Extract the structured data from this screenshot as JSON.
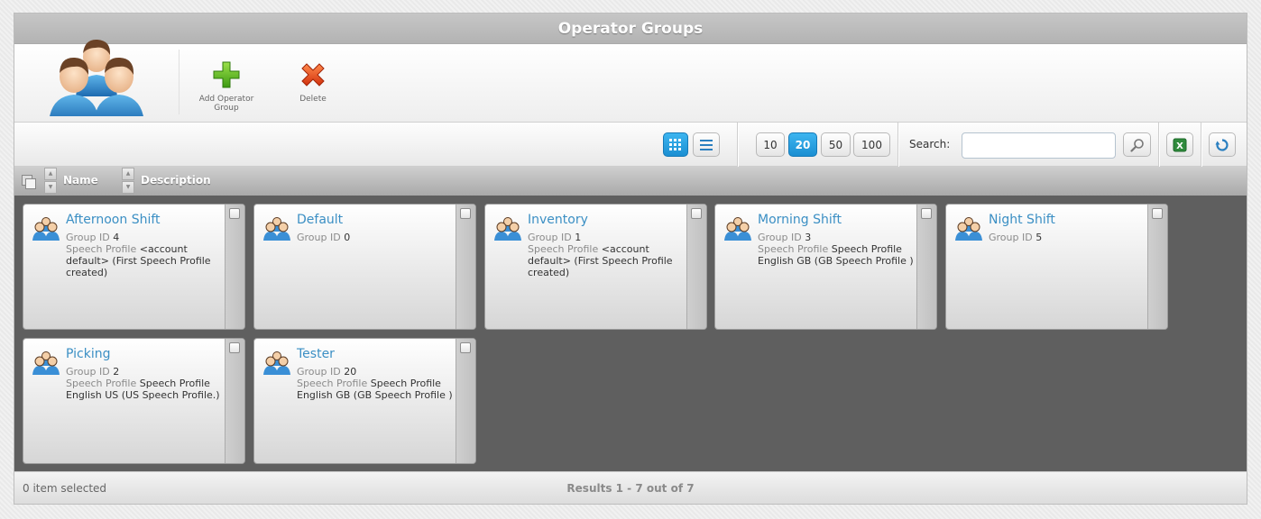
{
  "window": {
    "title": "Operator Groups"
  },
  "toolbar": {
    "add_label": "Add Operator Group",
    "delete_label": "Delete"
  },
  "filter": {
    "page_sizes": [
      "10",
      "20",
      "50",
      "100"
    ],
    "active_page_size": "20",
    "search_label": "Search:",
    "search_value": "",
    "search_placeholder": ""
  },
  "columns": {
    "name": "Name",
    "description": "Description"
  },
  "labels": {
    "group_id": "Group ID",
    "speech_profile": "Speech Profile"
  },
  "groups": [
    {
      "name": "Afternoon Shift",
      "group_id": "4",
      "speech_profile": "<account default> (First Speech Profile created)"
    },
    {
      "name": "Default",
      "group_id": "0",
      "speech_profile": ""
    },
    {
      "name": "Inventory",
      "group_id": "1",
      "speech_profile": "<account default> (First Speech Profile created)"
    },
    {
      "name": "Morning Shift",
      "group_id": "3",
      "speech_profile": "Speech Profile English GB (GB Speech Profile )"
    },
    {
      "name": "Night Shift",
      "group_id": "5",
      "speech_profile": ""
    },
    {
      "name": "Picking",
      "group_id": "2",
      "speech_profile": "Speech Profile English US (US Speech Profile.)"
    },
    {
      "name": "Tester",
      "group_id": "20",
      "speech_profile": "Speech Profile English GB (GB Speech Profile )"
    }
  ],
  "footer": {
    "selected_text": "0 item selected",
    "results_text": "Results 1 - 7 out of 7"
  },
  "colors": {
    "accent": "#1b8fd2",
    "link": "#3b8fc4",
    "grid_background": "#5f5f5f"
  },
  "icons": {
    "hero": "operator-group-icon",
    "add": "green-plus-icon",
    "delete": "red-x-icon",
    "grid_view": "grid-view-icon",
    "list_view": "list-view-icon",
    "search": "magnifier-icon",
    "export": "excel-icon",
    "refresh": "refresh-icon"
  }
}
